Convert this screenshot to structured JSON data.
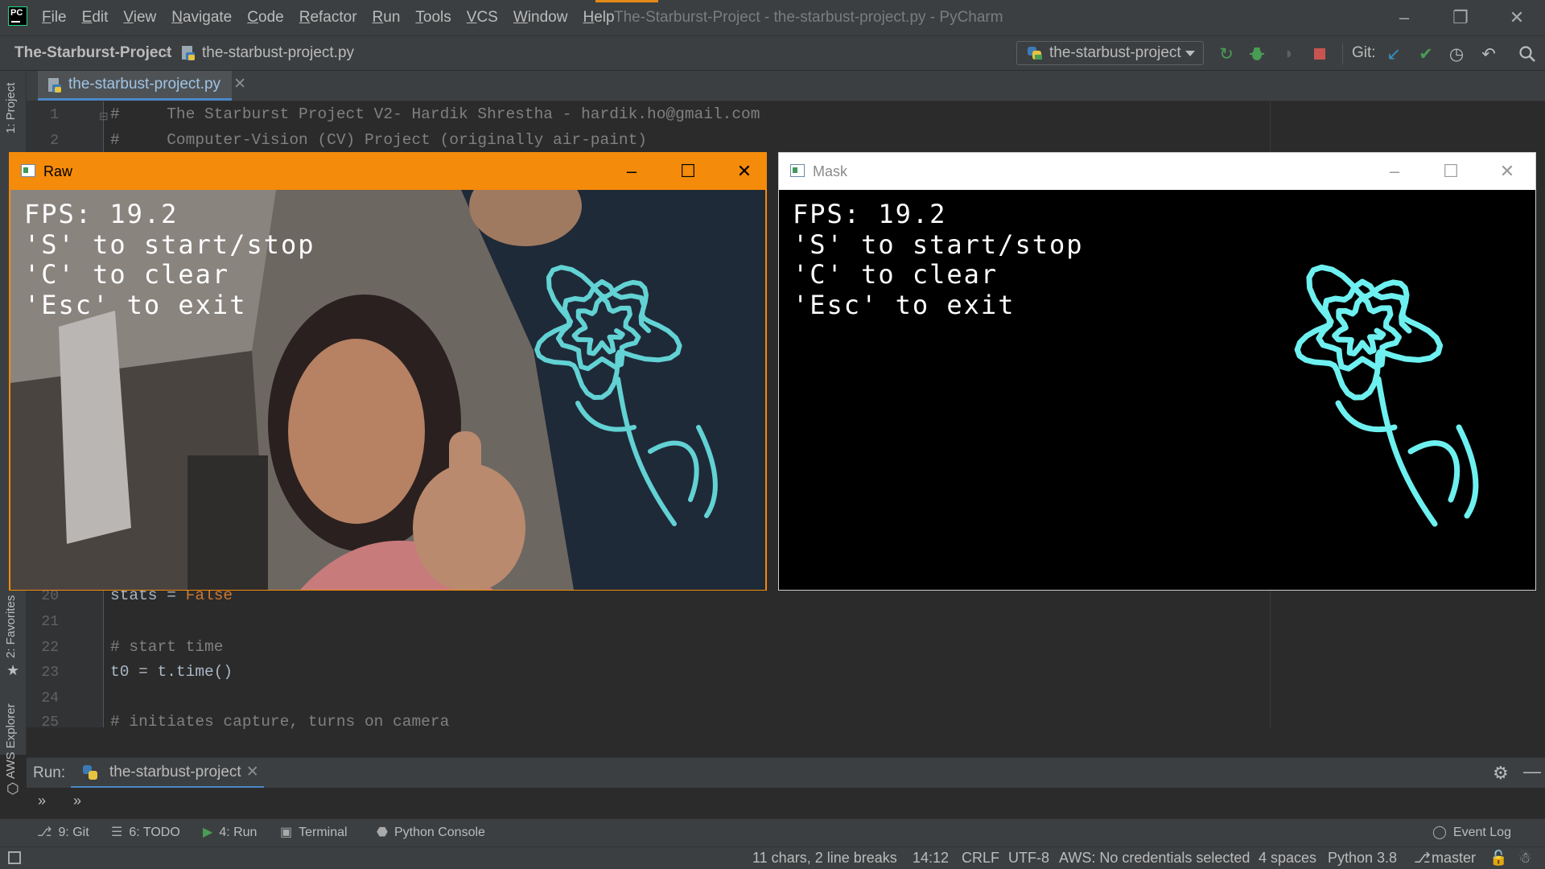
{
  "window": {
    "title": "The-Starburst-Project - the-starbust-project.py - PyCharm",
    "minimize_icon": "minimize-icon",
    "maximize_icon": "restore-icon",
    "close_icon": "close-icon"
  },
  "menu": [
    "File",
    "Edit",
    "View",
    "Navigate",
    "Code",
    "Refactor",
    "Run",
    "Tools",
    "VCS",
    "Window",
    "Help"
  ],
  "breadcrumb": {
    "project": "The-Starburst-Project",
    "file": "the-starbust-project.py"
  },
  "toolbar": {
    "run_config": "the-starbust-project",
    "git_label": "Git:",
    "icons": [
      "rerun-icon",
      "debug-icon",
      "coverage-icon",
      "stop-icon",
      "vcs-update-icon",
      "vcs-commit-icon",
      "history-icon",
      "rollback-icon",
      "search-icon"
    ],
    "colors": {
      "run": "#499c54",
      "stop": "#c75450",
      "update": "#3592c4",
      "commit": "#499c54"
    }
  },
  "left_stripe": {
    "project": "1: Project",
    "favorites": "2: Favorites",
    "aws": "AWS Explorer"
  },
  "editor": {
    "tab_label": "the-starbust-project.py",
    "top_lines": [
      {
        "n": "1",
        "text": "#     The Starburst Project V2- Hardik Shrestha - hardik.ho@gmail.com"
      },
      {
        "n": "2",
        "text": "#     Computer-Vision (CV) Project (originally air-paint)"
      }
    ],
    "bottom_lines": [
      {
        "n": "20",
        "pre": "stats = ",
        "kw": "False"
      },
      {
        "n": "21",
        "pre": "",
        "kw": ""
      },
      {
        "n": "22",
        "comment": "# start time"
      },
      {
        "n": "23",
        "pre": "t0 = t.time()",
        "kw": ""
      },
      {
        "n": "24",
        "pre": "",
        "kw": ""
      },
      {
        "n": "25",
        "comment": "# initiates capture, turns on camera"
      }
    ]
  },
  "cv_windows": {
    "raw": {
      "title": "Raw",
      "accent": "#f58b0a"
    },
    "mask": {
      "title": "Mask",
      "accent": "#ffffff"
    },
    "overlay": {
      "fps": "FPS: 19.2",
      "line_start": "'S' to start/stop",
      "line_clear": "'C' to clear",
      "line_exit": "'Esc' to exit"
    },
    "stroke_color": "#6ef0f0"
  },
  "run_panel": {
    "label": "Run:",
    "tab": "the-starbust-project"
  },
  "bottom_tools": [
    {
      "icon": "git-branch-icon",
      "label": "9: Git"
    },
    {
      "icon": "todo-list-icon",
      "label": "6: TODO"
    },
    {
      "icon": "run-icon",
      "label": "4: Run"
    },
    {
      "icon": "terminal-icon",
      "label": "Terminal"
    },
    {
      "icon": "python-console-icon",
      "label": "Python Console"
    }
  ],
  "event_log": "Event Log",
  "status": {
    "selection": "11 chars, 2 line breaks",
    "position": "14:12",
    "line_sep": "CRLF",
    "encoding": "UTF-8",
    "aws": "AWS: No credentials selected",
    "indent": "4 spaces",
    "interpreter": "Python 3.8",
    "branch": "master"
  }
}
